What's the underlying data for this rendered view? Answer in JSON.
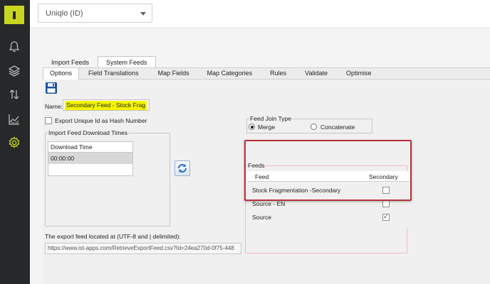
{
  "header": {
    "client_select_value": "Uniqlo (ID)"
  },
  "sidebar": {
    "items": [
      {
        "icon": "bell-icon",
        "name": "notifications"
      },
      {
        "icon": "layers-icon",
        "name": "layers"
      },
      {
        "icon": "sort-arrows-icon",
        "name": "transfers"
      },
      {
        "icon": "line-chart-icon",
        "name": "analytics"
      },
      {
        "icon": "gear-icon",
        "name": "settings",
        "active": true
      }
    ]
  },
  "tabs": [
    {
      "label": "Import Feeds",
      "active": false
    },
    {
      "label": "System Feeds",
      "active": true
    }
  ],
  "subtabs": [
    {
      "label": "Options",
      "active": true
    },
    {
      "label": "Field Translations",
      "active": false
    },
    {
      "label": "Map Fields",
      "active": false
    },
    {
      "label": "Map Categories",
      "active": false
    },
    {
      "label": "Rules",
      "active": false
    },
    {
      "label": "Validate",
      "active": false
    },
    {
      "label": "Optimise",
      "active": false
    }
  ],
  "form": {
    "name_label": "Name:",
    "name_value": "Secondary Feed - Stock Frag",
    "export_unique_label": "Export Unique Id as Hash Number",
    "download_group_title": "Import Feed Download Times",
    "download_table": {
      "header": "Download Time",
      "rows": [
        "00:00:00"
      ]
    },
    "export_label": "The export feed located at (UTF-8 and | delimited):",
    "export_url": "https://www.ist-apps.com/RetrieveExportFeed.csv?Id=24ea270d-0f75-448"
  },
  "feed_join": {
    "title": "Feed Join Type",
    "options": [
      {
        "label": "Merge",
        "selected": true
      },
      {
        "label": "Concatenate",
        "selected": false
      }
    ]
  },
  "feeds": {
    "title": "Feeds",
    "col_feed": "Feed",
    "col_secondary": "Secondary",
    "rows": [
      {
        "feed": "Stock Fragmentation -Secondary",
        "secondary": false
      },
      {
        "feed": "Source - EN",
        "secondary": false
      },
      {
        "feed": "Source",
        "secondary": true
      }
    ]
  },
  "colors": {
    "sidebar_bg": "#262829",
    "accent": "#c9d61f",
    "highlight_border": "#b8323a",
    "name_highlight": "#f4f400"
  }
}
